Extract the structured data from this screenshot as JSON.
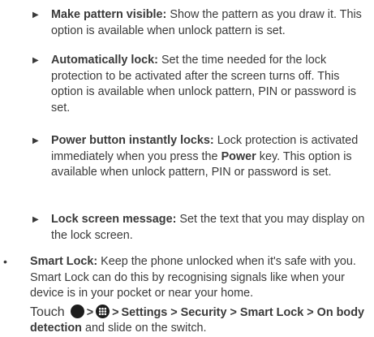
{
  "items": [
    {
      "title": "Make pattern visible:",
      "text": " Show the pattern as you draw it. This option is available when unlock pattern is set."
    },
    {
      "title": "Automatically lock:",
      "text": " Set the time needed for the lock protection to be activated after the screen turns off. This option is available when unlock pattern, PIN or password is set."
    },
    {
      "title": "Power button instantly locks:",
      "text_before": " Lock protection is activated immediately when you press the ",
      "power_key": "Power",
      "text_after": " key. This option is available when unlock pattern, PIN or password is set."
    },
    {
      "title": "Lock screen message:",
      "text": " Set the text that you may display on the lock screen."
    }
  ],
  "smart_lock": {
    "title": "Smart Lock:",
    "text": " Keep the phone unlocked when it's safe with you. Smart Lock can do this by recognising signals like when your device is in your pocket or near your home.",
    "touch_word": "Touch",
    "sep": ">",
    "path": "Settings > Security > Smart Lock > On body detection",
    "path_end": " and slide on the switch."
  },
  "symbols": {
    "arrow": "▶",
    "bullet": "•"
  },
  "icons": [
    "home-circle-icon",
    "all-apps-icon"
  ]
}
